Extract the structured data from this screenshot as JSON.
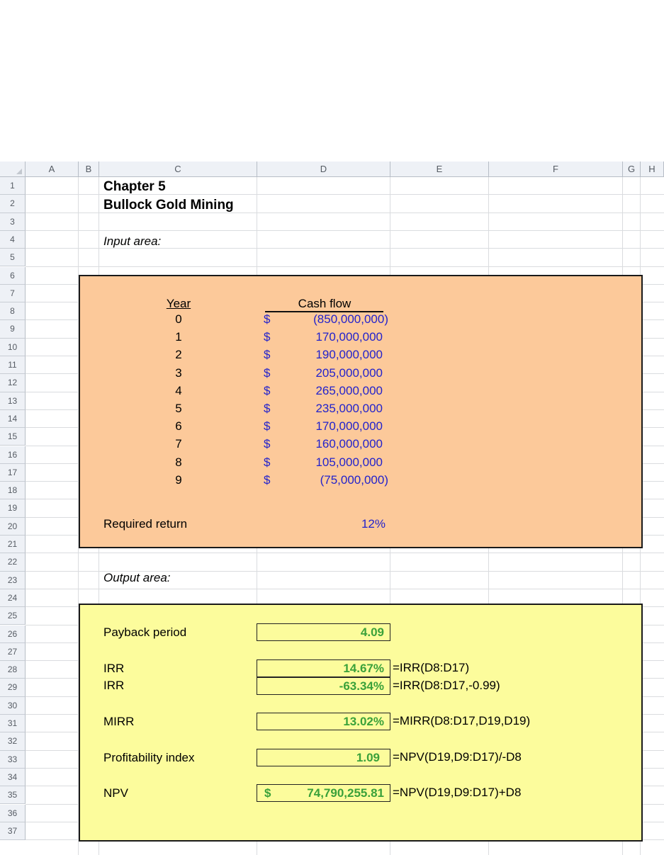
{
  "spreadsheet": {
    "columns": [
      "A",
      "B",
      "C",
      "D",
      "E",
      "F",
      "G",
      "H"
    ],
    "rows": [
      "1",
      "2",
      "3",
      "4",
      "5",
      "6",
      "7",
      "8",
      "9",
      "10",
      "11",
      "12",
      "13",
      "14",
      "15",
      "16",
      "17",
      "18",
      "19",
      "20",
      "21",
      "22",
      "23",
      "24",
      "25",
      "26",
      "27",
      "28",
      "29",
      "30",
      "31",
      "32",
      "33",
      "34",
      "35",
      "36",
      "37"
    ]
  },
  "title": {
    "chapter": "Chapter 5",
    "company": "Bullock Gold Mining"
  },
  "input": {
    "area_label": "Input area:",
    "year_header": "Year",
    "cashflow_header": "Cash flow",
    "currency_symbol": "$",
    "rows": [
      {
        "year": "0",
        "cash_flow": "(850,000,000)"
      },
      {
        "year": "1",
        "cash_flow": "170,000,000"
      },
      {
        "year": "2",
        "cash_flow": "190,000,000"
      },
      {
        "year": "3",
        "cash_flow": "205,000,000"
      },
      {
        "year": "4",
        "cash_flow": "265,000,000"
      },
      {
        "year": "5",
        "cash_flow": "235,000,000"
      },
      {
        "year": "6",
        "cash_flow": "170,000,000"
      },
      {
        "year": "7",
        "cash_flow": "160,000,000"
      },
      {
        "year": "8",
        "cash_flow": "105,000,000"
      },
      {
        "year": "9",
        "cash_flow": "(75,000,000)"
      }
    ],
    "required_return_label": "Required return",
    "required_return_value": "12%"
  },
  "output": {
    "area_label": "Output area:",
    "payback_label": "Payback period",
    "payback_value": "4.09",
    "irr1_label": "IRR",
    "irr1_value": "14.67%",
    "irr1_formula": "=IRR(D8:D17)",
    "irr2_label": "IRR",
    "irr2_value": "-63.34%",
    "irr2_formula": "=IRR(D8:D17,-0.99)",
    "mirr_label": "MIRR",
    "mirr_value": "13.02%",
    "mirr_formula": "=MIRR(D8:D17,D19,D19)",
    "pi_label": "Profitability index",
    "pi_value": "1.09",
    "pi_formula": "=NPV(D19,D9:D17)/-D8",
    "npv_label": "NPV",
    "npv_currency": "$",
    "npv_value": "74,790,255.81",
    "npv_formula": "=NPV(D19,D9:D17)+D8"
  },
  "colors": {
    "input_fill": "#fcc99a",
    "output_fill": "#fcfc9c",
    "input_text": "#2222cc",
    "output_value_text": "#3aa13a"
  }
}
